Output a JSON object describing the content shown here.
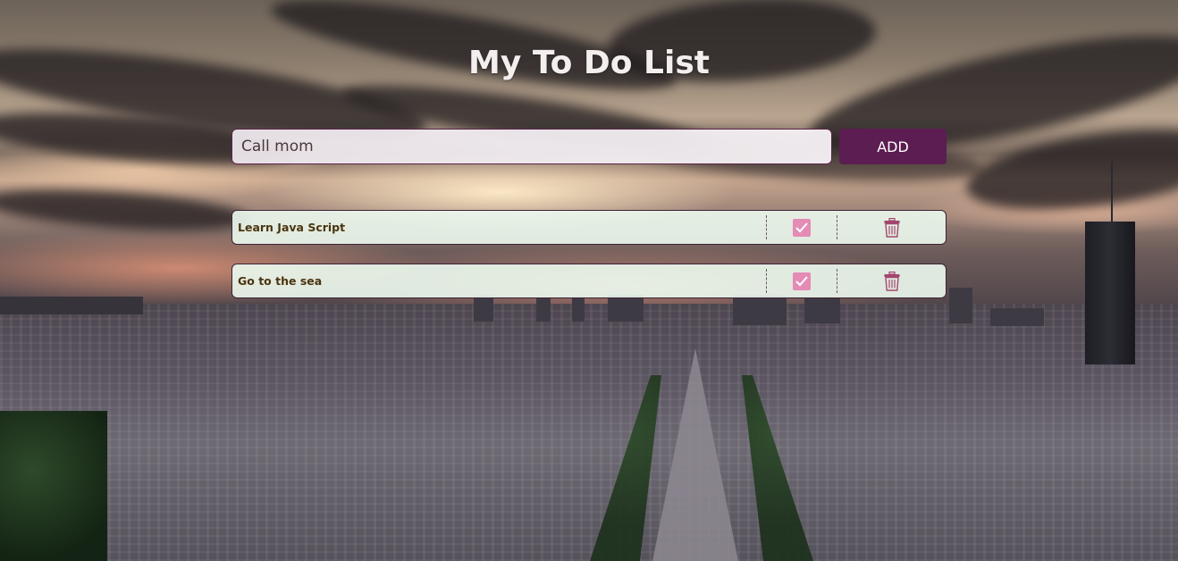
{
  "app": {
    "title": "My To Do List"
  },
  "new_task": {
    "value": "Call mom"
  },
  "add_button": {
    "label": "ADD"
  },
  "todos": [
    {
      "text": "Learn Java Script",
      "checked": true
    },
    {
      "text": "Go to the sea",
      "checked": true
    }
  ],
  "icons": {
    "check": "checkmark-icon",
    "delete": "trash-icon"
  },
  "colors": {
    "accent": "#5c1d52",
    "check_fill": "#e48bb6",
    "trash": "#a3466e",
    "todo_background": "#ecfaee",
    "todo_text": "#4a3410"
  }
}
